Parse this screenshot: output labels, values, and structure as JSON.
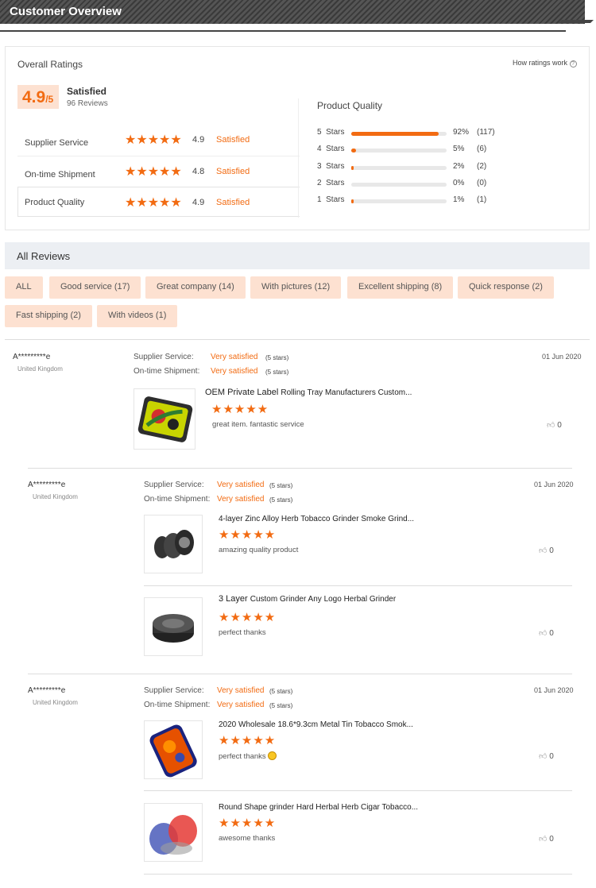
{
  "header": {
    "title": "Customer Overview"
  },
  "overview": {
    "title": "Overall Ratings",
    "how_link": "How ratings work",
    "score": "4.9",
    "score_suffix": "/5",
    "overall_label": "Satisfied",
    "review_count": "96 Reviews",
    "rows": [
      {
        "label": "Supplier Service",
        "value": "4.9",
        "status": "Satisfied"
      },
      {
        "label": "On-time Shipment",
        "value": "4.8",
        "status": "Satisfied"
      },
      {
        "label": "Product Quality",
        "value": "4.9",
        "status": "Satisfied"
      }
    ],
    "quality": {
      "title": "Product Quality",
      "rows": [
        {
          "label": "5  Stars",
          "pct": "92%",
          "count": "(117)",
          "fill": 0.92
        },
        {
          "label": "4  Stars",
          "pct": "5%",
          "count": "(6)",
          "fill": 0.05
        },
        {
          "label": "3  Stars",
          "pct": "2%",
          "count": "(2)",
          "fill": 0.02
        },
        {
          "label": "2  Stars",
          "pct": "0%",
          "count": "(0)",
          "fill": 0.0
        },
        {
          "label": "1  Stars",
          "pct": "1%",
          "count": "(1)",
          "fill": 0.01
        }
      ]
    }
  },
  "reviews": {
    "title": "All Reviews",
    "filters": [
      "ALL",
      "Good service (17)",
      "Great company (14)",
      "With pictures (12)",
      "Excellent shipping (8)",
      "Quick response (2)",
      "Fast shipping (2)",
      "With videos (1)"
    ],
    "supplier_label": "Supplier Service:",
    "shipment_label": "On-time Shipment:",
    "very_satisfied": "Very satisfied",
    "five_stars": "(5 stars)",
    "items": [
      {
        "name": "A*********e",
        "country": "United Kingdom",
        "date": "01 Jun 2020",
        "products": [
          {
            "title_a": "OEM Private Label ",
            "title_b": "Rolling Tray Manufacturers Custom...",
            "text": "great item. fantastic service",
            "likes": "0"
          }
        ]
      },
      {
        "name": "A*********e",
        "country": "United Kingdom",
        "date": "01 Jun 2020",
        "products": [
          {
            "title_a": "",
            "title_b": "4-layer Zinc Alloy Herb Tobacco Grinder Smoke Grind...",
            "text": "amazing quality product",
            "likes": "0"
          },
          {
            "title_a": " 3 Layer ",
            "title_b": "Custom Grinder Any Logo Herbal Grinder",
            "text": "perfect thanks",
            "likes": "0"
          }
        ]
      },
      {
        "name": "A*********e",
        "country": "United Kingdom",
        "date": "01 Jun 2020",
        "products": [
          {
            "title_a": "",
            "title_b": "2020 Wholesale 18.6*9.3cm Metal Tin Tobacco Smok...",
            "text": "perfect thanks",
            "likes": "0"
          },
          {
            "title_a": "",
            "title_b": "Round Shape grinder Hard Herbal Herb Cigar Tobacco...",
            "text": "awesome thanks",
            "likes": "0"
          }
        ]
      }
    ]
  },
  "stars": "★★★★★",
  "colors": {
    "accent": "#f26b12",
    "chip_bg": "#fde1d1"
  }
}
